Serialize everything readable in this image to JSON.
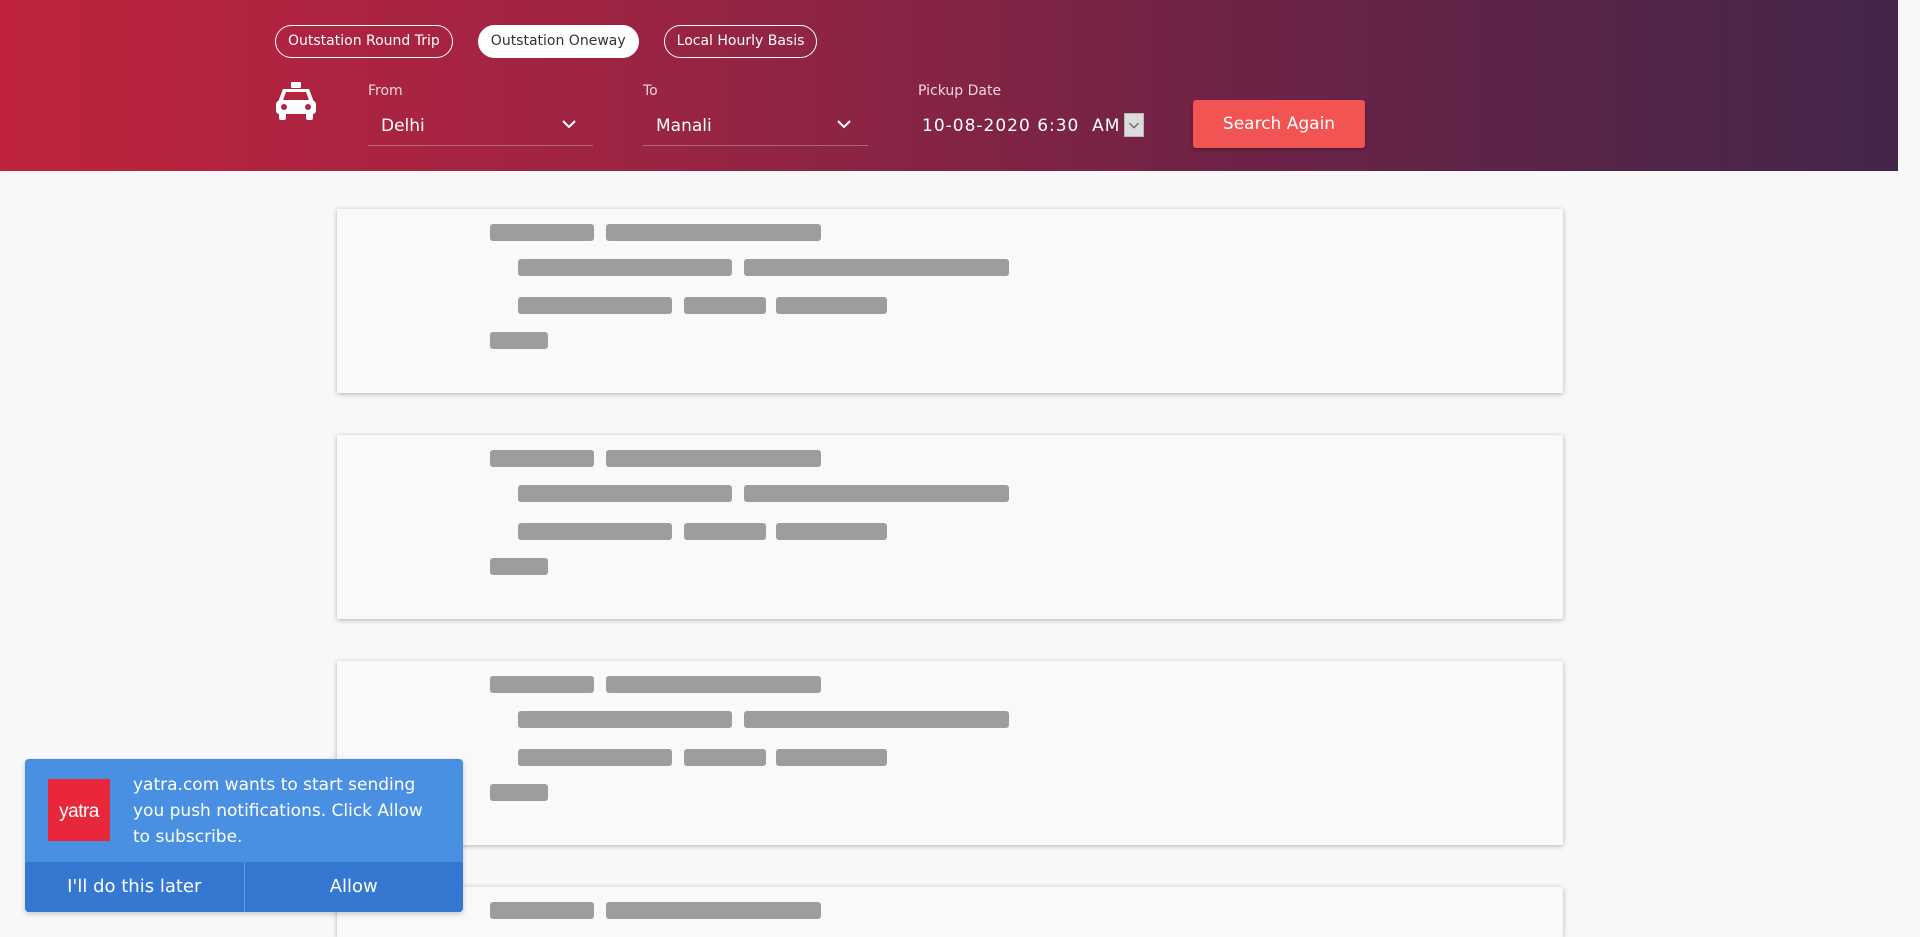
{
  "trip_tabs": [
    {
      "label": "Outstation Round Trip",
      "active": false
    },
    {
      "label": "Outstation Oneway",
      "active": true
    },
    {
      "label": "Local Hourly Basis",
      "active": false
    }
  ],
  "search_form": {
    "from_label": "From",
    "from_value": "Delhi",
    "to_label": "To",
    "to_value": "Manali",
    "date_label": "Pickup Date",
    "date_value": "10-08-2020 6:30  AM",
    "search_button": "Search Again"
  },
  "notification": {
    "logo_text": "yatra",
    "message": "yatra.com wants to start sending you push notifications. Click Allow to subscribe.",
    "later_button": "I'll do this later",
    "allow_button": "Allow"
  },
  "colors": {
    "header_start": "#bf233d",
    "header_end": "#43264a",
    "search_button": "#f25353",
    "notification_bg": "#4a90e2",
    "notification_actions": "#3578d1",
    "logo_bg": "#e8283a",
    "skeleton_bar": "#9d9d9d"
  }
}
